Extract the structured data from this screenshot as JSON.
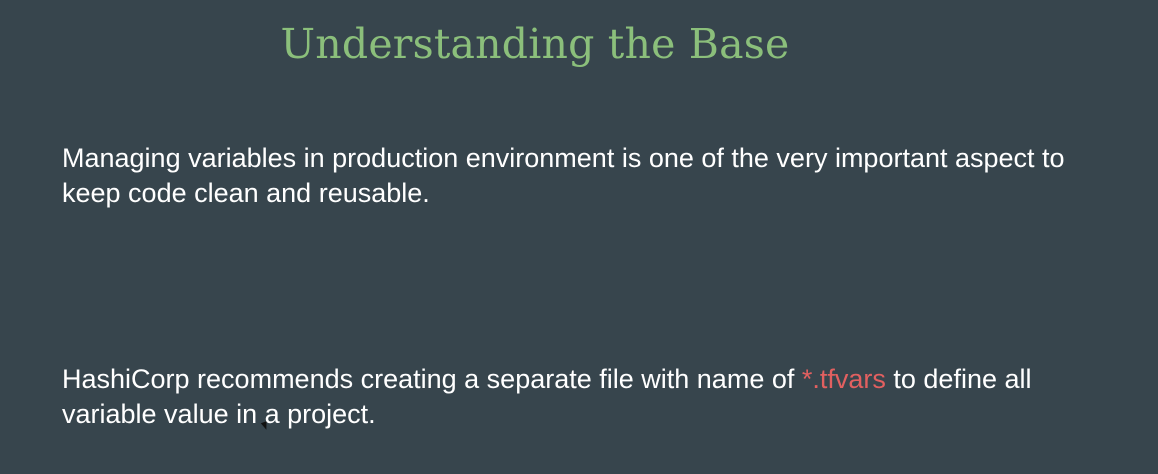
{
  "slide": {
    "title": "Understanding the Base",
    "paragraph1": "Managing variables in production environment is one of the very important aspect to keep code clean and reusable.",
    "paragraph2": {
      "before": "HashiCorp recommends creating a separate file with name of ",
      "highlight": "*.tfvars",
      "after": " to define all variable value in a project."
    }
  },
  "colors": {
    "background": "#37454d",
    "title": "#8bbf7b",
    "body_text": "#ffffff",
    "highlight": "#e26060"
  },
  "icons": {
    "cursor": "mouse-pointer-icon"
  }
}
